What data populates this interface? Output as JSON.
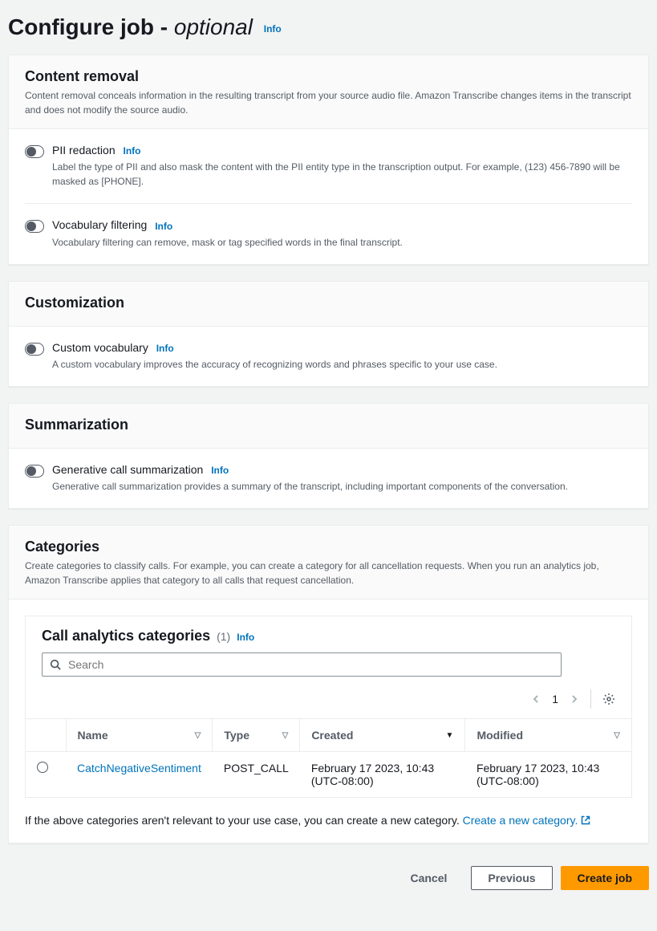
{
  "page": {
    "title_main": "Configure job",
    "title_sep": " - ",
    "title_optional": "optional",
    "info": "Info"
  },
  "content_removal": {
    "title": "Content removal",
    "desc": "Content removal conceals information in the resulting transcript from your source audio file. Amazon Transcribe changes items in the transcript and does not modify the source audio.",
    "pii": {
      "title": "PII redaction",
      "info": "Info",
      "desc": "Label the type of PII and also mask the content with the PII entity type in the transcription output. For example, (123) 456-7890 will be masked as [PHONE]."
    },
    "vocab_filter": {
      "title": "Vocabulary filtering",
      "info": "Info",
      "desc": "Vocabulary filtering can remove, mask or tag specified words in the final transcript."
    }
  },
  "customization": {
    "title": "Customization",
    "custom_vocab": {
      "title": "Custom vocabulary",
      "info": "Info",
      "desc": "A custom vocabulary improves the accuracy of recognizing words and phrases specific to your use case."
    }
  },
  "summarization": {
    "title": "Summarization",
    "gen": {
      "title": "Generative call summarization",
      "info": "Info",
      "desc": "Generative call summarization provides a summary of the transcript, including important components of the conversation."
    }
  },
  "categories": {
    "title": "Categories",
    "desc": "Create categories to classify calls. For example, you can create a category for all cancellation requests. When you run an analytics job, Amazon Transcribe applies that category to all calls that request cancellation.",
    "table_title": "Call analytics categories",
    "count": "(1)",
    "info": "Info",
    "search_placeholder": "Search",
    "page_num": "1",
    "columns": {
      "name": "Name",
      "type": "Type",
      "created": "Created",
      "modified": "Modified"
    },
    "row": {
      "name": "CatchNegativeSentiment",
      "type": "POST_CALL",
      "created": "February 17 2023, 10:43 (UTC-08:00)",
      "modified": "February 17 2023, 10:43 (UTC-08:00)"
    },
    "note_prefix": "If the above categories aren't relevant to your use case, you can create a new category. ",
    "note_link": "Create a new category."
  },
  "footer": {
    "cancel": "Cancel",
    "previous": "Previous",
    "create": "Create job"
  }
}
